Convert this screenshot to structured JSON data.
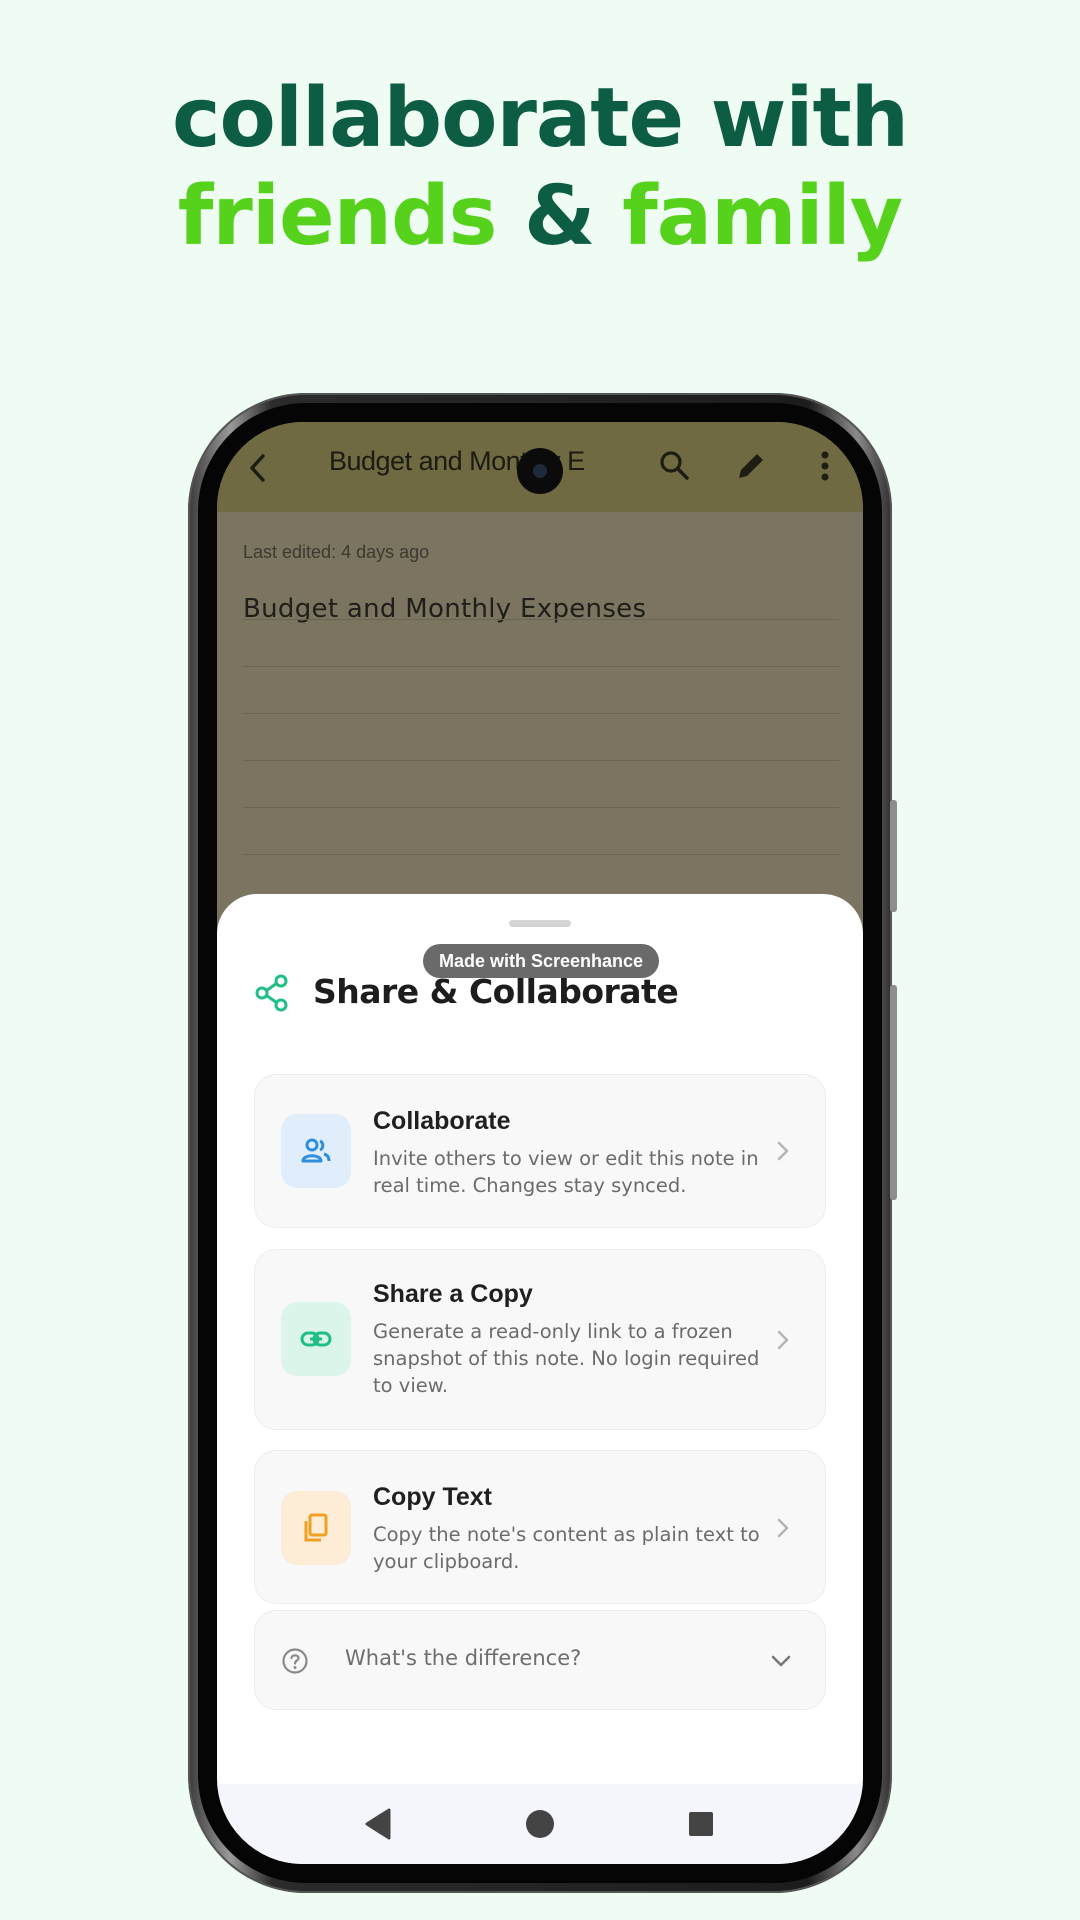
{
  "headline": {
    "line1": "collaborate with",
    "line2_part1": "friends",
    "line2_amp": "&",
    "line2_part2": "family"
  },
  "appbar": {
    "title": "Budget and Monthly E",
    "icons": [
      "back-icon",
      "search-icon",
      "edit-icon",
      "more-vert-icon"
    ]
  },
  "note": {
    "last_edited": "Last edited: 4 days ago",
    "title": "Budget and Monthly Expenses"
  },
  "sheet": {
    "watermark": "Made with Screenhance",
    "title": "Share & Collaborate",
    "icon": "share-icon",
    "options": [
      {
        "title": "Collaborate",
        "description": "Invite others to view or edit this note in real time. Changes stay synced.",
        "icon": "people-icon",
        "color": "#2f8fdc"
      },
      {
        "title": "Share a Copy",
        "description": "Generate a read-only link to a frozen snapshot of this note. No login required to view.",
        "icon": "link-icon",
        "color": "#1fbf84"
      },
      {
        "title": "Copy Text",
        "description": "Copy the note's content as plain text to your clipboard.",
        "icon": "copy-icon",
        "color": "#f0a020"
      }
    ],
    "faq": {
      "label": "What's the difference?",
      "icon": "help-icon"
    }
  },
  "navbar": {
    "icons": [
      "nav-back-icon",
      "nav-home-icon",
      "nav-recents-icon"
    ]
  },
  "colors": {
    "background": "#eefcf3",
    "headline_dark": "#0d5c44",
    "headline_green": "#57d21c",
    "accent": "#1fbf84"
  }
}
